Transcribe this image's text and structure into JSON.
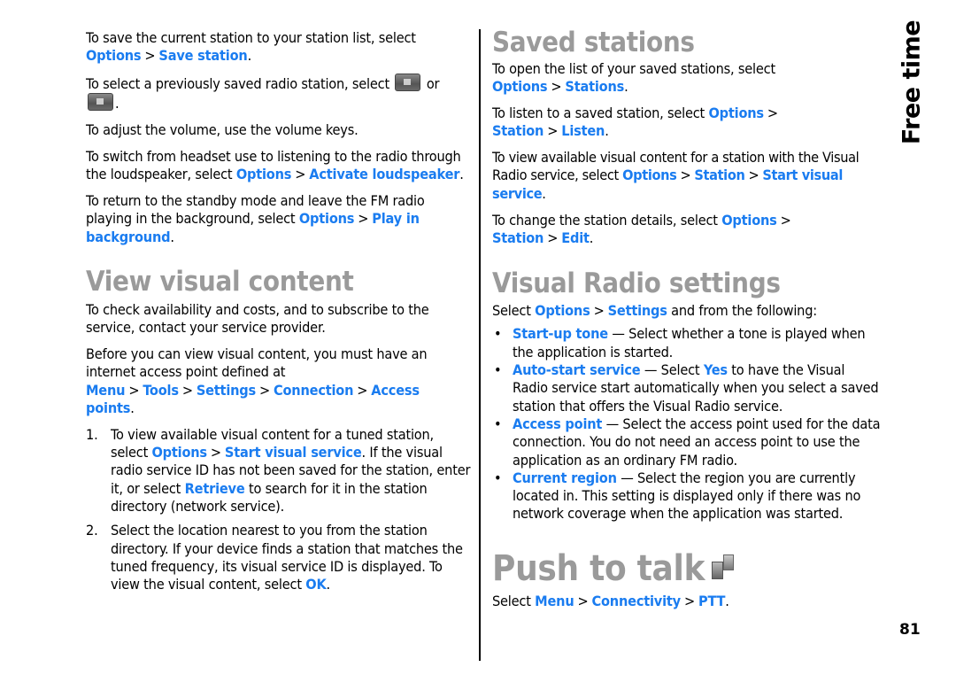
{
  "side_label": "Free time",
  "page_number": "81",
  "colors": {
    "link": "#1a7cf0",
    "heading": "#9a9a9a",
    "text": "#000000"
  },
  "left": {
    "p1": {
      "text": "To save the current station to your station list, select ",
      "path": [
        "Options",
        "Save station"
      ],
      "end": "."
    },
    "p2": {
      "text": "To select a previously saved radio station, select ",
      "icon_next": "next-station-icon",
      "mid": " or ",
      "icon_prev": "previous-station-icon",
      "end": "."
    },
    "p3": {
      "text": "To adjust the volume, use the volume keys."
    },
    "p4": {
      "text": "To switch from headset use to listening to the radio through the loudspeaker, select ",
      "path": [
        "Options",
        "Activate loudspeaker"
      ],
      "end": "."
    },
    "p5": {
      "text": "To return to the standby mode and leave the FM radio playing in the background, select ",
      "path": [
        "Options",
        "Play in background"
      ],
      "end": "."
    },
    "view_visual": {
      "heading": "View visual content",
      "p1": "To check availability and costs, and to subscribe to the service, contact your service provider.",
      "p2": {
        "text": "Before you can view visual content, you must have an internet access point defined at ",
        "path": [
          "Menu",
          "Tools",
          "Settings",
          "Connection",
          "Access points"
        ],
        "end": "."
      },
      "steps": [
        {
          "num": "1.",
          "a": "To view available visual content for a tuned station, select ",
          "path": [
            "Options",
            "Start visual service"
          ],
          "b": ". If the visual radio service ID has not been saved for the station, enter it, or select ",
          "link": "Retrieve",
          "c": " to search for it in the station directory (network service)."
        },
        {
          "num": "2.",
          "a": "Select the location nearest to you from the station directory. If your device finds a station that matches the tuned frequency, its visual service ID is displayed. To view the visual content, select ",
          "link": "OK",
          "c": "."
        }
      ]
    }
  },
  "right": {
    "saved": {
      "heading": "Saved stations",
      "p1": {
        "text": "To open the list of your saved stations, select ",
        "path": [
          "Options",
          "Stations"
        ],
        "end": "."
      },
      "p2": {
        "text": "To listen to a saved station, select ",
        "path": [
          "Options",
          "Station",
          "Listen"
        ],
        "end": "."
      },
      "p3": {
        "text": "To view available visual content for a station with the Visual Radio service, select ",
        "path": [
          "Options",
          "Station",
          "Start visual service"
        ],
        "end": "."
      },
      "p4": {
        "text": "To change the station details, select ",
        "path": [
          "Options",
          "Station",
          "Edit"
        ],
        "end": "."
      }
    },
    "settings": {
      "heading": "Visual Radio settings",
      "intro": {
        "text": "Select ",
        "path": [
          "Options",
          "Settings"
        ],
        "end": " and from the following:"
      },
      "items": [
        {
          "term": "Start-up tone",
          "desc": " — Select whether a tone is played when the application is started."
        },
        {
          "term": "Auto-start service",
          "desc_a": " — Select ",
          "link": "Yes",
          "desc": " to have the Visual Radio service start automatically when you select a saved station that offers the Visual Radio service."
        },
        {
          "term": "Access point",
          "desc": " — Select the access point used for the data connection. You do not need an access point to use the application as an ordinary FM radio."
        },
        {
          "term": "Current region",
          "desc": " — Select the region you are currently located in. This setting is displayed only if there was no network coverage when the application was started."
        }
      ]
    },
    "ptt": {
      "heading": "Push to talk",
      "icon": "push-to-talk-icon",
      "p1": {
        "text": "Select ",
        "path": [
          "Menu",
          "Connectivity",
          "PTT"
        ],
        "end": "."
      }
    }
  },
  "separator": ">"
}
